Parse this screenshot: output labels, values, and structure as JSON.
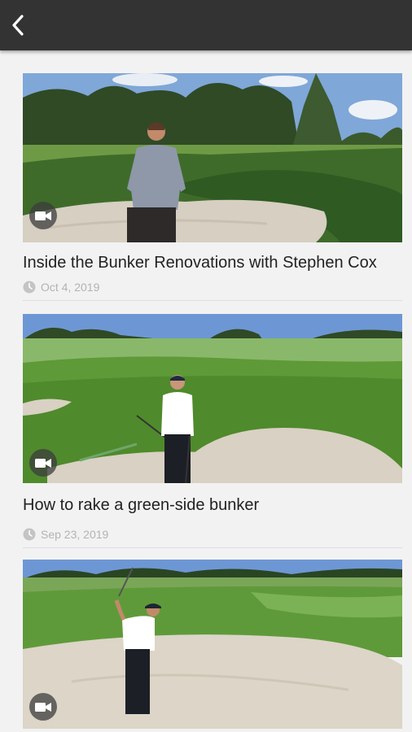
{
  "header": {
    "back_icon": "chevron-left-icon"
  },
  "videos": [
    {
      "title": "Inside the Bunker Renovations with Stephen Cox",
      "date": "Oct 4, 2019",
      "type_icon": "video-camera-icon",
      "date_icon": "clock-icon"
    },
    {
      "title": "How to rake a green-side bunker",
      "date": "Sep 23, 2019",
      "type_icon": "video-camera-icon",
      "date_icon": "clock-icon"
    },
    {
      "title": "",
      "date": "",
      "type_icon": "video-camera-icon"
    }
  ],
  "colors": {
    "topbar": "#333333",
    "background": "#f2f2f2",
    "title_text": "#222222",
    "meta_text": "#b3b3b3"
  }
}
